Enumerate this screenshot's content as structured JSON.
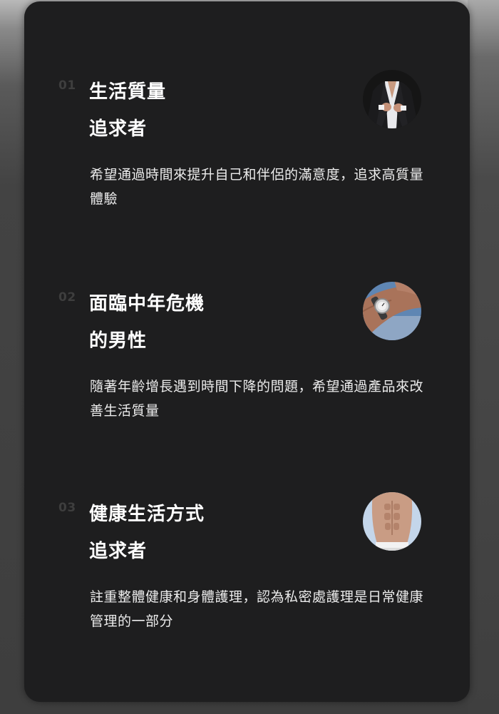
{
  "segments": [
    {
      "number": "01",
      "title_line1": "生活質量",
      "title_line2": "追求者",
      "description": "希望通過時間來提升自己和伴侶的滿意度，追求高質量體驗",
      "image_icon": "man-in-suit-photo"
    },
    {
      "number": "02",
      "title_line1": "面臨中年危機",
      "title_line2": "的男性",
      "description": "隨著年齡增長遇到時間下降的問題，希望通過產品來改善生活質量",
      "image_icon": "wristwatch-photo"
    },
    {
      "number": "03",
      "title_line1": "健康生活方式",
      "title_line2": "追求者",
      "description": "註重整體健康和身體護理，認為私密處護理是日常健康管理的一部分",
      "image_icon": "abs-torso-photo"
    }
  ],
  "colors": {
    "card_background": "#1e1e1f",
    "number_color": "#3e3e3e",
    "title_color": "#ffffff",
    "text_color": "#ececec"
  }
}
